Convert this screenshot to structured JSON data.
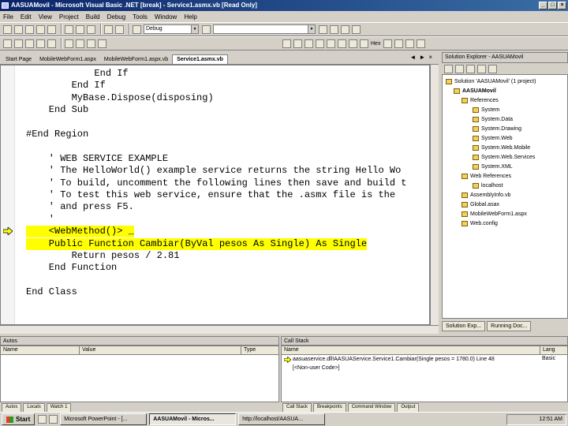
{
  "window": {
    "title": "AASUAMovil - Microsoft Visual Basic .NET [break] - Service1.asmx.vb [Read Only]"
  },
  "menu": [
    "File",
    "Edit",
    "View",
    "Project",
    "Build",
    "Debug",
    "Tools",
    "Window",
    "Help"
  ],
  "toolbar": {
    "config": "Debug",
    "find_combo": "",
    "hex_label": "Hex"
  },
  "tabs": [
    "Start Page",
    "MobileWebForm1.aspx",
    "MobileWebForm1.aspx.vb",
    "Service1.asmx.vb"
  ],
  "code": [
    {
      "text": "            End If",
      "highlight": false
    },
    {
      "text": "        End If",
      "highlight": false
    },
    {
      "text": "        MyBase.Dispose(disposing)",
      "highlight": false
    },
    {
      "text": "    End Sub",
      "highlight": false
    },
    {
      "text": "",
      "highlight": false
    },
    {
      "text": "#End Region",
      "highlight": false
    },
    {
      "text": "",
      "highlight": false
    },
    {
      "text": "    ' WEB SERVICE EXAMPLE",
      "highlight": false
    },
    {
      "text": "    ' The HelloWorld() example service returns the string Hello Wo",
      "highlight": false
    },
    {
      "text": "    ' To build, uncomment the following lines then save and build t",
      "highlight": false
    },
    {
      "text": "    ' To test this web service, ensure that the .asmx file is the",
      "highlight": false
    },
    {
      "text": "    ' and press F5.",
      "highlight": false
    },
    {
      "text": "    '",
      "highlight": false
    },
    {
      "text": "    <WebMethod()> _",
      "highlight": true
    },
    {
      "text": "    Public Function Cambiar(ByVal pesos As Single) As Single",
      "highlight": true
    },
    {
      "text": "        Return pesos / 2.81",
      "highlight": false
    },
    {
      "text": "    End Function",
      "highlight": false
    },
    {
      "text": "",
      "highlight": false
    },
    {
      "text": "End Class",
      "highlight": false
    }
  ],
  "solution": {
    "header": "Solution Explorer - AASUAMovil",
    "items": [
      {
        "label": "Solution 'AASUAMovil' (1 project)",
        "bold": false
      },
      {
        "label": "AASUAMovil",
        "bold": true
      },
      {
        "label": "References",
        "bold": false
      },
      {
        "label": "System",
        "bold": false
      },
      {
        "label": "System.Data",
        "bold": false
      },
      {
        "label": "System.Drawing",
        "bold": false
      },
      {
        "label": "System.Web",
        "bold": false
      },
      {
        "label": "System.Web.Mobile",
        "bold": false
      },
      {
        "label": "System.Web.Services",
        "bold": false
      },
      {
        "label": "System.XML",
        "bold": false
      },
      {
        "label": "Web References",
        "bold": false
      },
      {
        "label": "localhost",
        "bold": false
      },
      {
        "label": "AssemblyInfo.vb",
        "bold": false
      },
      {
        "label": "Global.asax",
        "bold": false
      },
      {
        "label": "MobileWebForm1.aspx",
        "bold": false
      },
      {
        "label": "Web.config",
        "bold": false
      }
    ],
    "tab_solution": "Solution Exp...",
    "tab_running": "Running Doc..."
  },
  "autos": {
    "title": "Autos",
    "columns": [
      "Name",
      "Value",
      "Type"
    ],
    "tabs": [
      "Autos",
      "Locals",
      "Watch 1"
    ]
  },
  "callstack": {
    "title": "Call Stack",
    "columns": [
      "Name",
      "Lang"
    ],
    "rows": [
      {
        "name": "aasuaservice.dll!AASUAService.Service1.Cambiar(Single pesos = 1780.0) Line 48",
        "lang": "Basic"
      },
      {
        "name": "[<Non-user Code>]",
        "lang": ""
      }
    ],
    "tabs": [
      "Call Stack",
      "Breakpoints",
      "Command Window",
      "Output"
    ]
  },
  "taskbar": {
    "start": "Start",
    "buttons": [
      "Microsoft PowerPoint - [...",
      "AASUAMovil - Micros...",
      "http://localhost/AASUA..."
    ],
    "active_index": 1,
    "clock": "12:51 AM"
  }
}
